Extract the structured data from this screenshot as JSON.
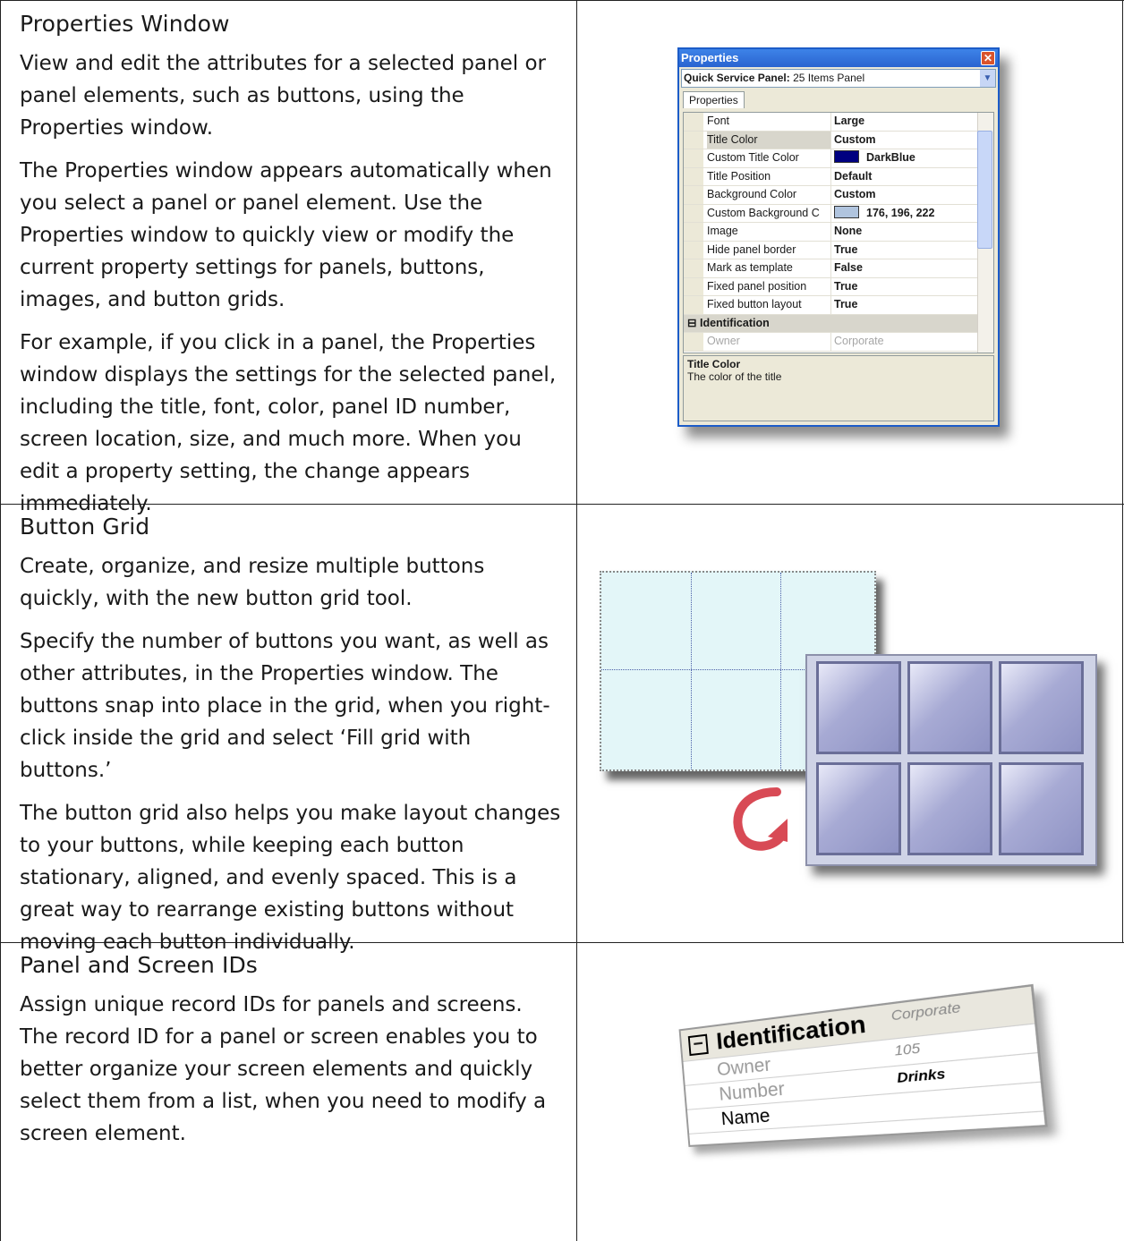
{
  "sections": [
    {
      "title": "Properties Window",
      "paragraphs": [
        "View and edit the attributes for a selected panel or panel elements, such as buttons, using the Properties window.",
        "The Properties window appears automatically when you select a panel or panel element. Use the Properties window to quickly view or modify the current property settings for panels, buttons, images, and button grids.",
        "For example, if you click in a panel, the Properties window displays the settings for the selected panel, including the title, font, color, panel ID number, screen location, size, and much more. When you edit a property setting, the change appears immediately."
      ]
    },
    {
      "title": "Button Grid",
      "paragraphs": [
        "Create, organize, and resize multiple buttons quickly, with the new button grid tool.",
        "Specify the number of buttons you want, as well as other attributes, in the Properties window. The buttons snap into place in the grid, when you right-click inside the grid and select ‘Fill grid with buttons.’",
        "The button grid also helps you make layout changes to your buttons, while keeping each button stationary, aligned, and evenly spaced. This is a great way to rearrange existing buttons without moving each button individually."
      ]
    },
    {
      "title": "Panel and Screen IDs",
      "paragraphs": [
        "Assign unique record IDs for panels and screens. The record ID for a panel or screen enables you to better organize your screen elements and quickly select them from a list, when you need to modify a screen element."
      ]
    }
  ],
  "properties_window": {
    "title": "Properties",
    "selector_bold": "Quick Service Panel:",
    "selector_rest": " 25 Items Panel",
    "tab": "Properties",
    "rows": [
      {
        "name": "Font",
        "value": "Large"
      },
      {
        "name": "Title Color",
        "value": "Custom"
      },
      {
        "name": "Custom Title Color",
        "value": "DarkBlue",
        "swatch": "#000080"
      },
      {
        "name": "Title Position",
        "value": "Default"
      },
      {
        "name": "Background Color",
        "value": "Custom"
      },
      {
        "name": "Custom Background C",
        "value": "176, 196, 222",
        "swatch": "#b0c4de"
      },
      {
        "name": "Image",
        "value": "None"
      },
      {
        "name": "Hide panel border",
        "value": "True"
      },
      {
        "name": "Mark as template",
        "value": "False"
      },
      {
        "name": "Fixed panel position",
        "value": "True"
      },
      {
        "name": "Fixed button layout",
        "value": "True"
      }
    ],
    "category": "Identification",
    "category_rows": [
      {
        "name": "Owner",
        "value": "Corporate"
      }
    ],
    "desc_title": "Title Color",
    "desc_text": "The color of the title"
  },
  "identification_card": {
    "title": "Identification",
    "rows": [
      {
        "name": "Owner",
        "value": "Corporate"
      },
      {
        "name": "Number",
        "value": "105"
      },
      {
        "name": "Name",
        "value": "Drinks"
      }
    ]
  }
}
